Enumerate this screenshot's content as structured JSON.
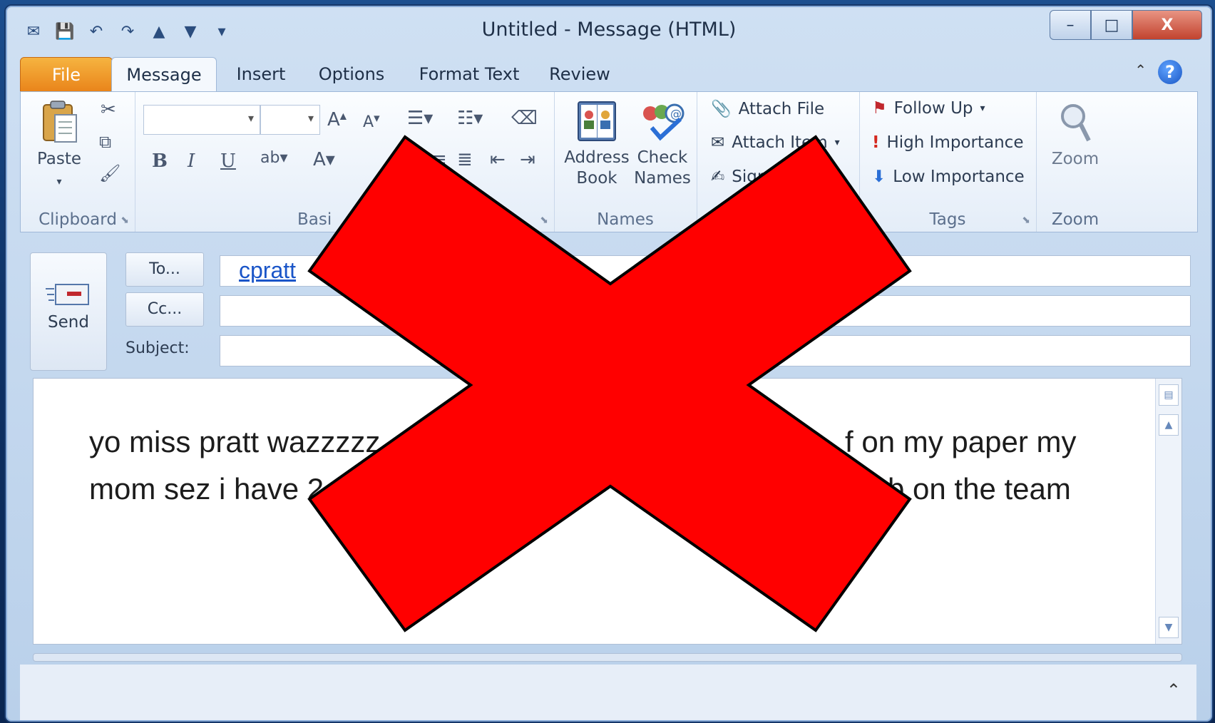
{
  "window": {
    "title": "Untitled  -  Message (HTML)",
    "controls": {
      "minimize": "–",
      "maximize": "□",
      "close": "X"
    }
  },
  "quick_access": [
    "mailbox-icon",
    "save-icon",
    "undo-icon",
    "redo-icon",
    "up-arrow-icon",
    "down-arrow-icon",
    "customize-icon"
  ],
  "tabs": [
    "File",
    "Message",
    "Insert",
    "Options",
    "Format Text",
    "Review"
  ],
  "active_tab": "Message",
  "help_glyph": "?",
  "ribbon": {
    "clipboard": {
      "label": "Clipboard",
      "paste": "Paste"
    },
    "basic_text": {
      "label": "Basic Text",
      "label_visible": "Basi",
      "bold": "B",
      "italic": "I",
      "underline": "U"
    },
    "names": {
      "label": "Names",
      "address_book": [
        "Address",
        "Book"
      ],
      "check_names": [
        "Check",
        "Names"
      ]
    },
    "include": {
      "attach_file": "Attach File",
      "attach_item": "Attach Item",
      "signature": "Signature"
    },
    "tags": {
      "label": "Tags",
      "follow_up": "Follow Up",
      "high_importance": "High Importance",
      "low_importance": "Low Importance"
    },
    "zoom": {
      "label": "Zoom",
      "button": "Zoom"
    }
  },
  "compose": {
    "send": "Send",
    "to_button": "To...",
    "cc_button": "Cc...",
    "subject_label": "Subject:",
    "to_value": "cpratt",
    "cc_value": "",
    "subject_value": ""
  },
  "body": {
    "line1_left": "yo miss pratt wazzzzz",
    "line1_right": "f on my paper my",
    "line2_left": "mom sez i have 2",
    "line2_right": "b on the team"
  },
  "overlay": {
    "shape": "red-x-mark",
    "color": "#ff0000"
  }
}
